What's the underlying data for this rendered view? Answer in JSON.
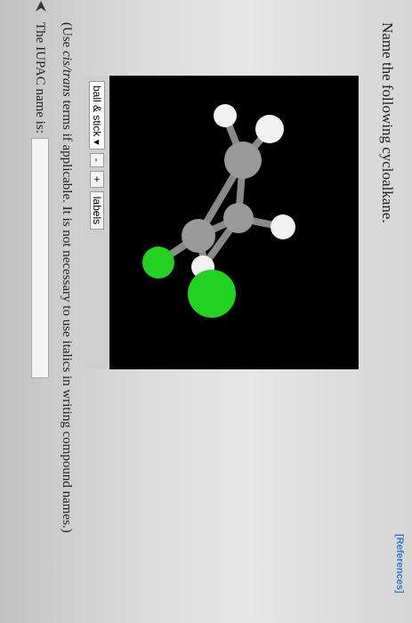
{
  "header": {
    "references_label": "[References]"
  },
  "question": {
    "prompt": "Name the following cycloalkane."
  },
  "viewer": {
    "mode_option": "ball & stick",
    "minus_label": "-",
    "plus_label": "+",
    "labels_button": "labels",
    "colors": {
      "carbon": "#9a9a9a",
      "hydrogen": "#f2f2f2",
      "chlorine": "#22d222"
    }
  },
  "instructions": {
    "prefix": "(Use ",
    "emphasis": "cis/trans",
    "suffix": " terms if applicable. It is not necessary to use italics in writing compound names.)"
  },
  "answer": {
    "label": "The IUPAC name is:",
    "value": ""
  }
}
